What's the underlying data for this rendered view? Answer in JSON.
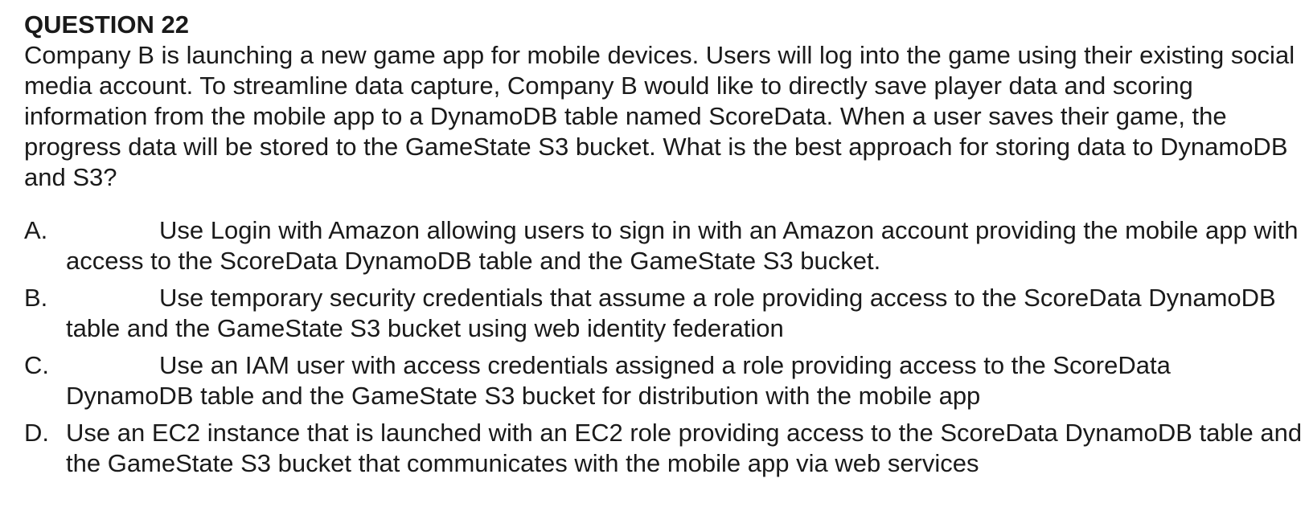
{
  "question": {
    "title": "QUESTION 22",
    "text": "Company B is launching a new game app for mobile devices. Users will log into the game using their existing social media account. To streamline data capture, Company B would like to directly save player data and scoring information from the mobile app to a DynamoDB table named ScoreData. When a user saves their game, the progress data will be stored to the GameState S3 bucket. What is the best approach for storing data to DynamoDB and S3?"
  },
  "options": [
    {
      "letter": "A.",
      "text": "Use Login with Amazon allowing users to sign in with an Amazon account providing the mobile app with access to the ScoreData DynamoDB table and the GameState S3 bucket."
    },
    {
      "letter": "B.",
      "text": "Use temporary security credentials that assume a role providing access to the ScoreData DynamoDB table and the GameState S3 bucket using web identity federation"
    },
    {
      "letter": "C.",
      "text": "Use an IAM user with access credentials assigned a role providing access to the ScoreData DynamoDB table and the GameState S3 bucket for distribution with the mobile app"
    },
    {
      "letter": "D.",
      "text": "Use an EC2 instance that is launched with an EC2 role providing access to the ScoreData DynamoDB table and the GameState S3 bucket that communicates with the mobile app via web services"
    }
  ]
}
